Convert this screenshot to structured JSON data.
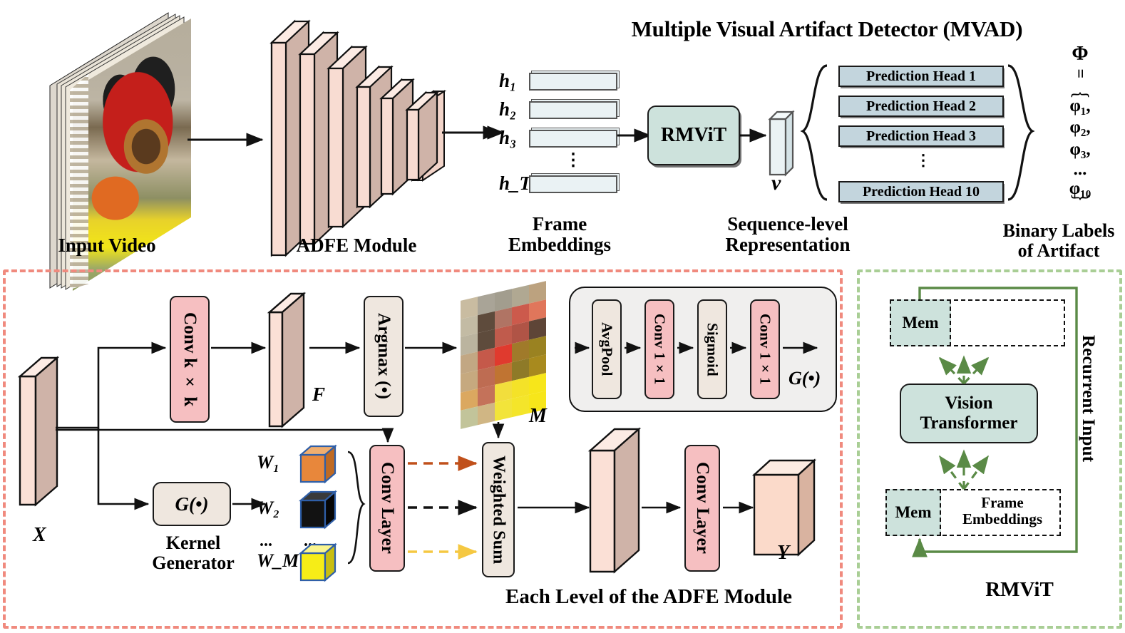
{
  "title": "Multiple Visual Artifact Detector (MVAD)",
  "top_pipeline": {
    "input_video_label": "Input Video",
    "adfe_label": "ADFE Module",
    "frame_embeddings_label": "Frame\nEmbeddings",
    "embedding_labels": [
      "h₁",
      "h₂",
      "h₃",
      "⋮",
      "h_T"
    ],
    "embedding_sub": [
      "1",
      "2",
      "3",
      "T"
    ],
    "rmvit_box_label": "RMViT",
    "sequence_vector_label": "v",
    "sequence_caption": "Sequence-level\nRepresentation",
    "prediction_heads": [
      "Prediction Head 1",
      "Prediction Head 2",
      "Prediction Head 3",
      "Prediction Head 10"
    ],
    "heads_ellipsis": "⋮",
    "binary_labels_caption": "Binary Labels\nof Artifact",
    "phi_symbol": "Φ",
    "equals_symbol": "=",
    "phi_items": [
      "φ₁,",
      "φ₂,",
      "φ₃,",
      "...",
      "φ₁₀"
    ]
  },
  "adfe_panel": {
    "caption": "Each Level of the ADFE Module",
    "border_color": "#F08A7E",
    "input_label": "X",
    "conv_k_label": "Conv k × k",
    "feature_label": "F",
    "argmax_label": "Argmax (•)",
    "mask_label": "M",
    "kernel_generator_label": "Kernel\nGenerator",
    "g_func_label": "G(•)",
    "weights": [
      "W₁",
      "W₂",
      "...",
      "W_M"
    ],
    "weight_colors": [
      "#E8873B",
      "#121212",
      "#F6ED17"
    ],
    "conv_layer_label": "Conv Layer",
    "weighted_sum_label": "Weighted Sum",
    "conv_layer_label2": "Conv Layer",
    "output_label": "Y",
    "g_module": {
      "label": "G(•)",
      "stages": [
        "AvgPool",
        "Conv 1×1",
        "Sigmoid",
        "Conv 1×1"
      ],
      "stage_colors": [
        "#EFE7DF",
        "#F6BFC1",
        "#EFE7DF",
        "#F6BFC1"
      ]
    },
    "dashed_arrow_colors": [
      "#C0501B",
      "#1a1a1a",
      "#F5C842"
    ],
    "mask_grid": [
      [
        "#C9BCA1",
        "#A9A497",
        "#A29D8E",
        "#B0A892",
        "#BCA27F"
      ],
      [
        "#C3BBA4",
        "#5E4B3C",
        "#B07464",
        "#CC5A4C",
        "#E0765B"
      ],
      [
        "#BBB49F",
        "#5E4B3C",
        "#C05B4C",
        "#B05446",
        "#5E4537"
      ],
      [
        "#C2A783",
        "#C5594A",
        "#E03A2E",
        "#A07A2A",
        "#9A8221"
      ],
      [
        "#C6A97F",
        "#BE6C52",
        "#C07432",
        "#8E7A28",
        "#A88A1E"
      ],
      [
        "#DBA860",
        "#C4725A",
        "#F2DE3C",
        "#F4E228",
        "#F7E61A"
      ],
      [
        "#C2C49A",
        "#D0B684",
        "#F2E43A",
        "#F4E52A",
        "#F7E61A"
      ]
    ]
  },
  "rmvit_panel": {
    "caption": "RMViT",
    "border_color": "#A9CE95",
    "mem_label_top": "Mem",
    "mem_label_bottom": "Mem",
    "frame_embeddings_label": "Frame\nEmbeddings",
    "vision_transformer_label": "Vision\nTransformer",
    "recurrent_input_label": "Recurrent Input",
    "loop_color": "#5A8A46"
  }
}
